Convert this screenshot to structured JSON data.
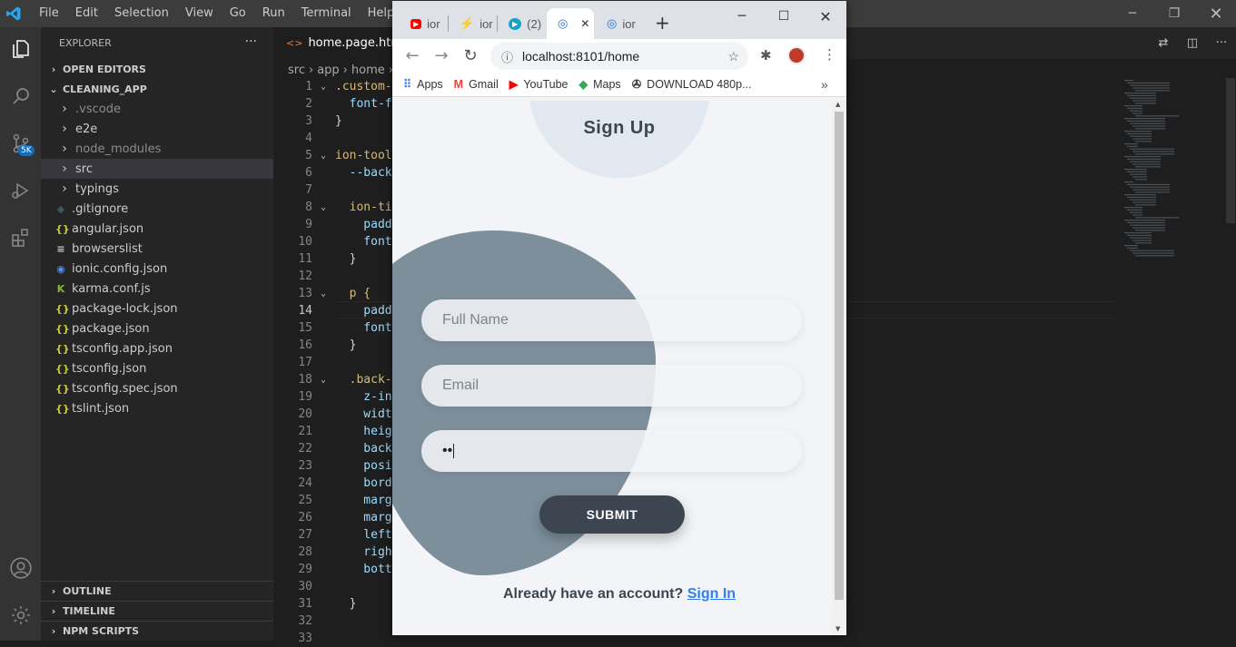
{
  "vscode": {
    "menu": [
      "File",
      "Edit",
      "Selection",
      "View",
      "Go",
      "Run",
      "Terminal",
      "Help"
    ],
    "explorer_title": "EXPLORER",
    "open_editors": "OPEN EDITORS",
    "project": "CLEANING_APP",
    "badge": "5K",
    "tree": [
      {
        "name": ".vscode",
        "type": "folder",
        "dim": true
      },
      {
        "name": "e2e",
        "type": "folder"
      },
      {
        "name": "node_modules",
        "type": "folder",
        "dim": true
      },
      {
        "name": "src",
        "type": "folder",
        "selected": true
      },
      {
        "name": "typings",
        "type": "folder"
      },
      {
        "name": ".gitignore",
        "type": "file",
        "icon": "◆"
      },
      {
        "name": "angular.json",
        "type": "file",
        "icon": "{}"
      },
      {
        "name": "browserslist",
        "type": "file",
        "icon": "≡"
      },
      {
        "name": "ionic.config.json",
        "type": "file",
        "icon": "◉"
      },
      {
        "name": "karma.conf.js",
        "type": "file",
        "icon": "K"
      },
      {
        "name": "package-lock.json",
        "type": "file",
        "icon": "{}"
      },
      {
        "name": "package.json",
        "type": "file",
        "icon": "{}"
      },
      {
        "name": "tsconfig.app.json",
        "type": "file",
        "icon": "{}"
      },
      {
        "name": "tsconfig.json",
        "type": "file",
        "icon": "{}"
      },
      {
        "name": "tsconfig.spec.json",
        "type": "file",
        "icon": "{}"
      },
      {
        "name": "tslint.json",
        "type": "file",
        "icon": "{}"
      }
    ],
    "bottom_sections": [
      "OUTLINE",
      "TIMELINE",
      "NPM SCRIPTS"
    ],
    "tab": "home.page.html",
    "breadcrumb": [
      "src",
      "app",
      "home"
    ],
    "lines": [
      {
        "n": "1",
        "text": ".custom-",
        "cls": "sel-c",
        "fold": true
      },
      {
        "n": "2",
        "text": "  font-f",
        "cls": "prop"
      },
      {
        "n": "3",
        "text": "}",
        "cls": "brace"
      },
      {
        "n": "4",
        "text": "",
        "cls": "brace"
      },
      {
        "n": "5",
        "text": "ion-tool",
        "cls": "sel-c",
        "fold": true
      },
      {
        "n": "6",
        "text": "  --back",
        "cls": "prop"
      },
      {
        "n": "7",
        "text": "",
        "cls": "brace"
      },
      {
        "n": "8",
        "text": "  ion-ti",
        "cls": "sel-c",
        "fold": true
      },
      {
        "n": "9",
        "text": "    padd",
        "cls": "prop"
      },
      {
        "n": "10",
        "text": "    font",
        "cls": "prop"
      },
      {
        "n": "11",
        "text": "  }",
        "cls": "brace"
      },
      {
        "n": "12",
        "text": "",
        "cls": "brace"
      },
      {
        "n": "13",
        "text": "  p {",
        "cls": "sel-c",
        "fold": true
      },
      {
        "n": "14",
        "text": "    padd",
        "cls": "prop",
        "current": true
      },
      {
        "n": "15",
        "text": "    font",
        "cls": "prop"
      },
      {
        "n": "16",
        "text": "  }",
        "cls": "brace"
      },
      {
        "n": "17",
        "text": "",
        "cls": "brace"
      },
      {
        "n": "18",
        "text": "  .back-",
        "cls": "sel-c",
        "fold": true
      },
      {
        "n": "19",
        "text": "    z-in",
        "cls": "prop"
      },
      {
        "n": "20",
        "text": "    widt",
        "cls": "prop"
      },
      {
        "n": "21",
        "text": "    heig",
        "cls": "prop"
      },
      {
        "n": "22",
        "text": "    back",
        "cls": "prop"
      },
      {
        "n": "23",
        "text": "    posi",
        "cls": "prop"
      },
      {
        "n": "24",
        "text": "    bord",
        "cls": "prop"
      },
      {
        "n": "25",
        "text": "    marg",
        "cls": "prop"
      },
      {
        "n": "26",
        "text": "    marg",
        "cls": "prop"
      },
      {
        "n": "27",
        "text": "    left",
        "cls": "prop"
      },
      {
        "n": "28",
        "text": "    righ",
        "cls": "prop"
      },
      {
        "n": "29",
        "text": "    bott",
        "cls": "prop"
      },
      {
        "n": "30",
        "text": "",
        "cls": "brace"
      },
      {
        "n": "31",
        "text": "  }",
        "cls": "brace"
      },
      {
        "n": "32",
        "text": "",
        "cls": "brace"
      },
      {
        "n": "33",
        "text": "",
        "cls": "brace"
      }
    ]
  },
  "chrome": {
    "tabs": [
      {
        "label": "ior",
        "icon": "youtube",
        "color": "#ff0000"
      },
      {
        "label": "ior",
        "icon": "bolt",
        "color": "#1a73e8"
      },
      {
        "label": "(2)",
        "icon": "play",
        "color": "#1aa3c8"
      },
      {
        "label": "",
        "icon": "ionic",
        "color": "#1a73e8",
        "active": true
      },
      {
        "label": "ior",
        "icon": "ionic",
        "color": "#1a73e8"
      }
    ],
    "close_glyph": "✕",
    "url": "localhost:8101/home",
    "bookmarks": [
      {
        "label": "Apps",
        "icon": "apps"
      },
      {
        "label": "Gmail",
        "icon": "gmail"
      },
      {
        "label": "YouTube",
        "icon": "youtube"
      },
      {
        "label": "Maps",
        "icon": "maps"
      },
      {
        "label": "DOWNLOAD 480p...",
        "icon": "film"
      }
    ],
    "more": "»"
  },
  "app": {
    "title": "Sign Up",
    "fullname_placeholder": "Full Name",
    "email_placeholder": "Email",
    "password_value": "••",
    "submit": "SUBMIT",
    "already": "Already have an account?",
    "signin": "Sign In",
    "colors": {
      "blob": "#7e8f9c",
      "dark": "#3d4650",
      "link": "#2f7ff0",
      "circle": "#e2e8ef"
    }
  }
}
